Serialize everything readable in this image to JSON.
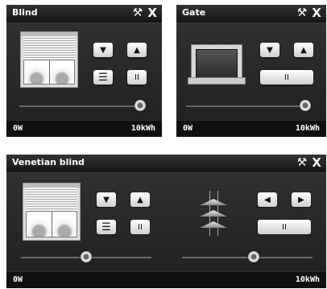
{
  "panels": [
    {
      "title": "Blind",
      "footer_left": "0W",
      "footer_right": "10kWh",
      "slider_value": 1.0,
      "buttons": {
        "down": "▼",
        "up": "▲",
        "stop": "II"
      }
    },
    {
      "title": "Gate",
      "footer_left": "0W",
      "footer_right": "10kWh",
      "slider_value": 1.0,
      "buttons": {
        "down": "▼",
        "up": "▲",
        "stop": "II"
      }
    },
    {
      "title": "Venetian blind",
      "footer_left": "0W",
      "footer_right": "10kWh",
      "slider_value": 0.5,
      "slider2_value": 0.55,
      "buttons": {
        "down": "▼",
        "up": "▲",
        "stop": "II",
        "left": "◀",
        "right": "▶",
        "stop2": "II"
      }
    }
  ],
  "icons": {
    "settings": "wrench-icon",
    "close": "close-icon",
    "close_glyph": "X"
  },
  "colors": {
    "panel_bg": "#1e1e1e",
    "button": "#ffffff",
    "text": "#ffffff"
  }
}
